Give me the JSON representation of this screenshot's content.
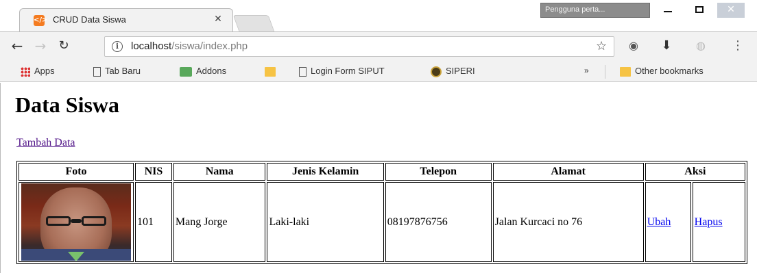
{
  "browser": {
    "tab_title": "CRUD Data Siswa",
    "tab_close": "✕",
    "profile_label": "Pengguna perta...",
    "url_host": "localhost",
    "url_path": "/siswa/index.php",
    "bookmarks": [
      {
        "label": "Apps",
        "icon": "apps-grid-icon"
      },
      {
        "label": "Tab Baru",
        "icon": "document-icon"
      },
      {
        "label": "Addons",
        "icon": "puzzle-icon"
      },
      {
        "label": "",
        "icon": "folder-icon"
      },
      {
        "label": "Login Form SIPUT",
        "icon": "document-icon"
      },
      {
        "label": "SIPERI",
        "icon": "coin-icon"
      }
    ],
    "bookmarks_overflow": "»",
    "other_bookmarks": "Other bookmarks"
  },
  "page": {
    "title": "Data Siswa",
    "add_link": "Tambah Data",
    "table": {
      "headers": [
        "Foto",
        "NIS",
        "Nama",
        "Jenis Kelamin",
        "Telepon",
        "Alamat",
        "Aksi"
      ],
      "rows": [
        {
          "nis": "101",
          "nama": "Mang Jorge",
          "jenis_kelamin": "Laki-laki",
          "telepon": "08197876756",
          "alamat": "Jalan Kurcaci no 76",
          "edit_label": "Ubah",
          "delete_label": "Hapus"
        }
      ]
    }
  },
  "colors": {
    "visited_link": "#551a8b",
    "link": "#0000ee",
    "favicon": "#f47b20"
  }
}
